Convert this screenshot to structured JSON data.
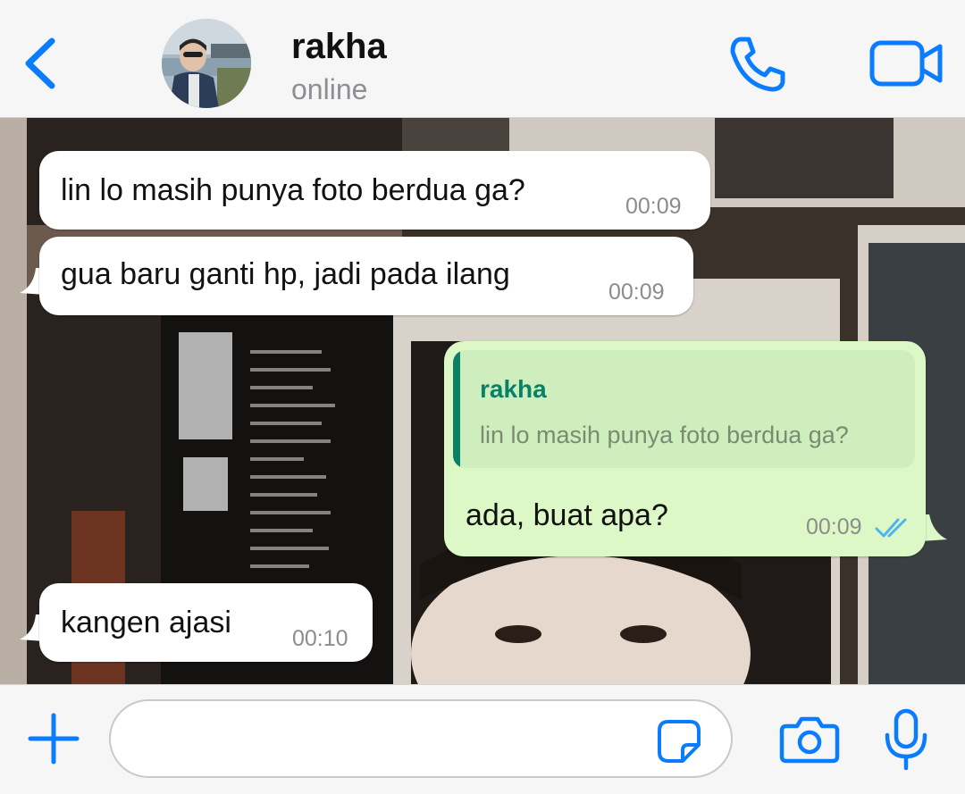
{
  "header": {
    "contact_name": "rakha",
    "status": "online"
  },
  "messages": [
    {
      "direction": "incoming",
      "text": "lin lo masih punya foto berdua ga?",
      "time": "00:09"
    },
    {
      "direction": "incoming",
      "text": "gua baru ganti hp, jadi pada ilang",
      "time": "00:09"
    },
    {
      "direction": "outgoing",
      "reply_to": {
        "name": "rakha",
        "text": "lin lo masih punya foto berdua ga?"
      },
      "text": "ada, buat apa?",
      "time": "00:09",
      "status": "read"
    },
    {
      "direction": "incoming",
      "text": "kangen ajasi",
      "time": "00:10"
    }
  ],
  "composer": {
    "value": "",
    "placeholder": ""
  },
  "icons": {
    "back": "chevron-left-icon",
    "call": "phone-icon",
    "video": "video-camera-icon",
    "attach": "plus-icon",
    "sticker": "sticker-icon",
    "camera": "camera-icon",
    "mic": "microphone-icon",
    "read_receipt": "double-check-icon"
  },
  "colors": {
    "accent": "#0a7cff",
    "incoming_bubble": "#ffffff",
    "outgoing_bubble": "#dcf8c6",
    "reply_accent": "#0a8066",
    "read_tick": "#4fb3f0"
  }
}
